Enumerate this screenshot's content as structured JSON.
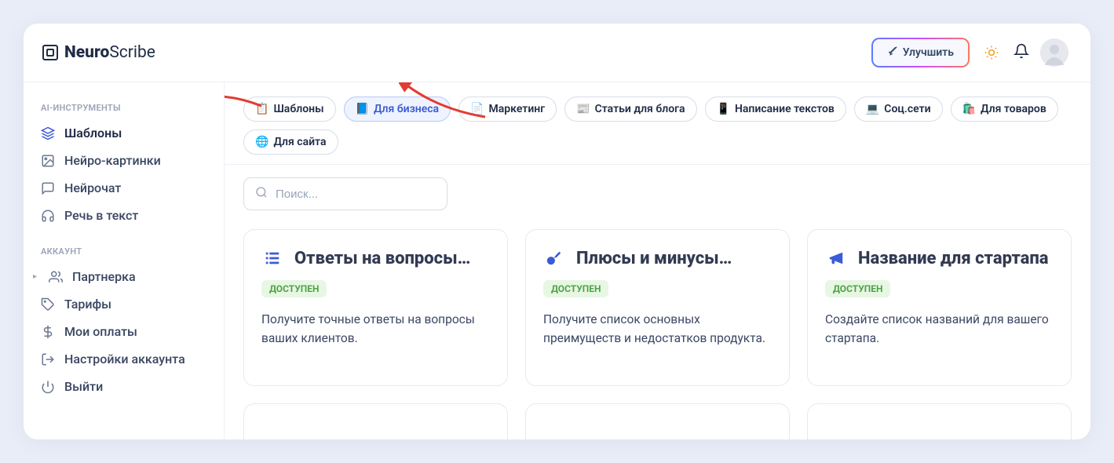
{
  "brand": {
    "bold": "Neuro",
    "light": "Scribe"
  },
  "header": {
    "upgrade_label": "Улучшить"
  },
  "sidebar": {
    "section_tools": "AI-ИНСТРУМЕНТЫ",
    "section_account": "АККАУНТ",
    "tools": [
      {
        "label": "Шаблоны"
      },
      {
        "label": "Нейро-картинки"
      },
      {
        "label": "Нейрочат"
      },
      {
        "label": "Речь в текст"
      }
    ],
    "account": [
      {
        "label": "Партнерка"
      },
      {
        "label": "Тарифы"
      },
      {
        "label": "Мои оплаты"
      },
      {
        "label": "Настройки аккаунта"
      },
      {
        "label": "Выйти"
      }
    ]
  },
  "filters": [
    {
      "icon": "📋",
      "label": "Шаблоны"
    },
    {
      "icon": "📘",
      "label": "Для бизнеса"
    },
    {
      "icon": "📄",
      "label": "Маркетинг"
    },
    {
      "icon": "📰",
      "label": "Статьи для блога"
    },
    {
      "icon": "📱",
      "label": "Написание текстов"
    },
    {
      "icon": "💻",
      "label": "Соц.сети"
    },
    {
      "icon": "🛍️",
      "label": "Для товаров"
    },
    {
      "icon": "🌐",
      "label": "Для сайта"
    }
  ],
  "search": {
    "placeholder": "Поиск..."
  },
  "badge_available": "ДОСТУПЕН",
  "cards": [
    {
      "title": "Ответы на вопросы…",
      "desc": "Получите точные ответы на вопросы ваших клиентов."
    },
    {
      "title": "Плюсы и минусы…",
      "desc": "Получите список основных преимуществ и недостатков продукта."
    },
    {
      "title": "Название для стартапа",
      "desc": "Создайте список названий для вашего стартапа."
    }
  ]
}
